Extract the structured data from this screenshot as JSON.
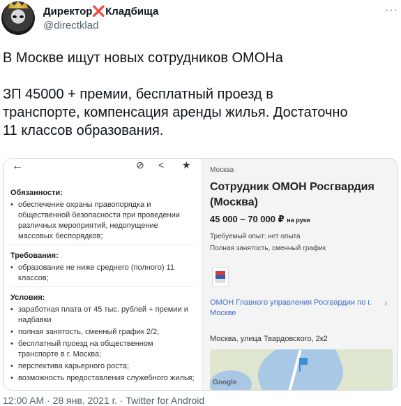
{
  "author": {
    "display_name": "Директор❌Кладбища",
    "handle": "@directklad"
  },
  "tweet": {
    "line1": "В Москве ищут новых сотрудников ОМОНа",
    "line2": "ЗП 45000 + премии, бесплатный проезд в",
    "line3": "транспорте, компенсация аренды жилья. Достаточно",
    "line4": "11 классов образования."
  },
  "screenshot": {
    "left_panel": {
      "duties_title": "Обязанности:",
      "duties": [
        "обеспечение охраны правопорядка и общественной безопасности при проведении различных мероприятий, недопущение массовых беспорядков;"
      ],
      "requirements_title": "Требования:",
      "requirements": [
        "образование не ниже среднего (полного) 11 классов;"
      ],
      "conditions_title": "Условия:",
      "conditions": [
        "заработная плата от 45 тыс. рублей + премии и надбавки",
        "полная занятость, сменный график 2/2;",
        "бесплатный проезд на общественном транспорте в г. Москва;",
        "перспектива карьерного роста;",
        "возможность предоставления служебного жилья;"
      ]
    },
    "right_panel": {
      "city": "Москва",
      "job_title": "Сотрудник ОМОН Росгвардия (Москва)",
      "salary": "45 000 – 70 000 ₽",
      "salary_note": "на руки",
      "experience": "Требуемый опыт: нет опыта",
      "employment": "Полная занятость, сменный график",
      "company": "ОМОН Главного управления Росгвардии по г. Москве",
      "address": "Москва, улица Твардовского, 2к2",
      "map_brand": "Google"
    }
  },
  "footer": {
    "timestamp": "12:00 AM · 28 янв. 2021 г. · Twitter for Android"
  }
}
